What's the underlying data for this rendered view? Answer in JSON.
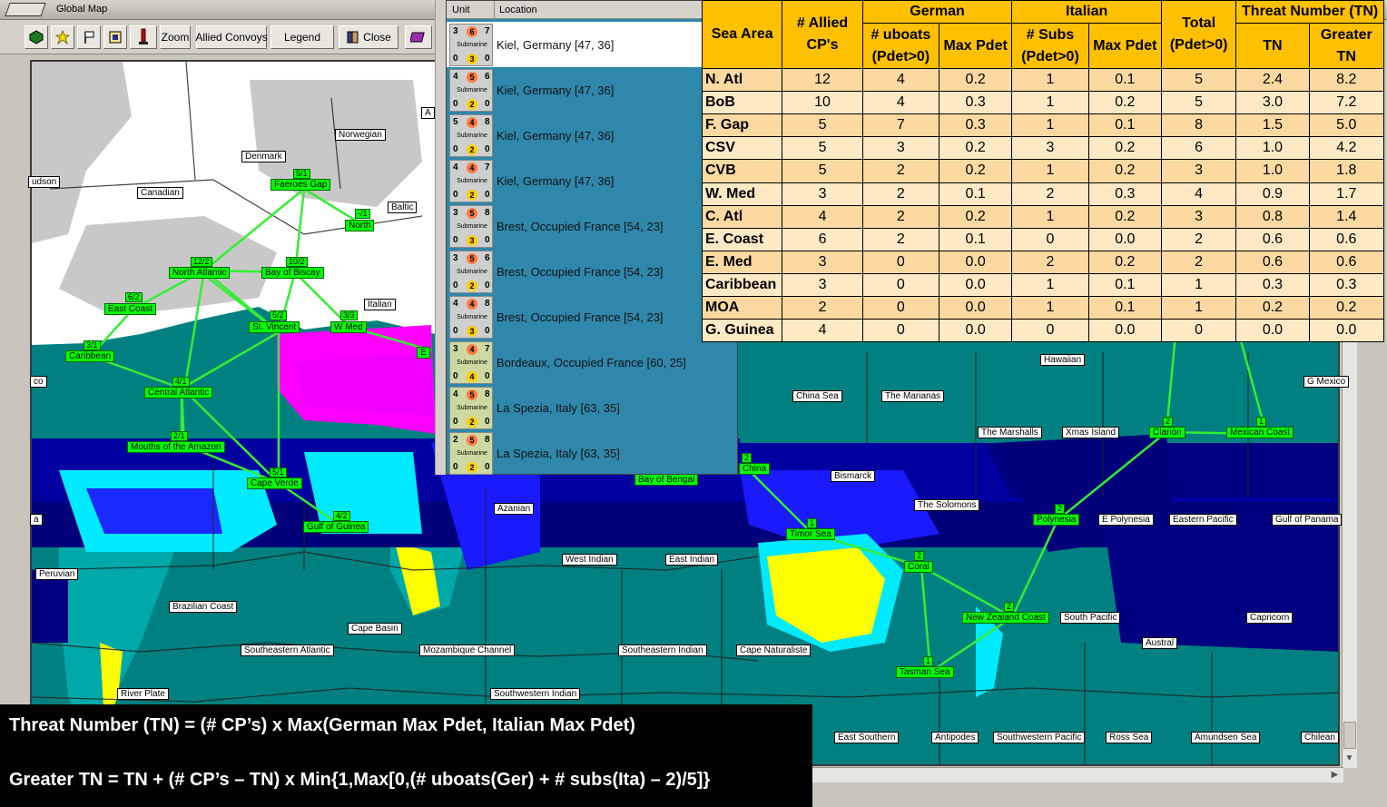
{
  "window": {
    "title": "Global Map"
  },
  "toolbar": {
    "zoom": "Zoom",
    "allied_convoys": "Allied Convoys",
    "legend": "Legend",
    "close": "Close"
  },
  "colors": {
    "ocean": "#008080",
    "land": "#ffffff",
    "detected": "#00ff00",
    "header": "#ffc000"
  },
  "units_panel": {
    "col_unit": "Unit",
    "col_location": "Location",
    "type_label": "Submarine",
    "rows": [
      {
        "t": "3",
        "tc": "6",
        "b": "7",
        "d": "0",
        "dc": "3",
        "e": "0",
        "loc": "Kiel, Germany [47, 36]",
        "ita": false
      },
      {
        "t": "4",
        "tc": "5",
        "b": "6",
        "d": "0",
        "dc": "2",
        "e": "0",
        "loc": "Kiel, Germany [47, 36]",
        "ita": false
      },
      {
        "t": "5",
        "tc": "4",
        "b": "8",
        "d": "0",
        "dc": "2",
        "e": "0",
        "loc": "Kiel, Germany [47, 36]",
        "ita": false
      },
      {
        "t": "4",
        "tc": "4",
        "b": "7",
        "d": "0",
        "dc": "2",
        "e": "0",
        "loc": "Kiel, Germany [47, 36]",
        "ita": false
      },
      {
        "t": "3",
        "tc": "5",
        "b": "8",
        "d": "0",
        "dc": "3",
        "e": "0",
        "loc": "Brest, Occupied France [54, 23]",
        "ita": false
      },
      {
        "t": "3",
        "tc": "5",
        "b": "6",
        "d": "0",
        "dc": "2",
        "e": "0",
        "loc": "Brest, Occupied France [54, 23]",
        "ita": false
      },
      {
        "t": "4",
        "tc": "4",
        "b": "8",
        "d": "0",
        "dc": "3",
        "e": "0",
        "loc": "Brest, Occupied France [54, 23]",
        "ita": false
      },
      {
        "t": "3",
        "tc": "4",
        "b": "7",
        "d": "0",
        "dc": "4",
        "e": "0",
        "loc": "Bordeaux, Occupied France [60, 25]",
        "ita": true
      },
      {
        "t": "4",
        "tc": "5",
        "b": "8",
        "d": "0",
        "dc": "2",
        "e": "0",
        "loc": "La Spezia, Italy [63, 35]",
        "ita": true
      },
      {
        "t": "2",
        "tc": "5",
        "b": "8",
        "d": "0",
        "dc": "2",
        "e": "0",
        "loc": "La Spezia, Italy [63, 35]",
        "ita": true
      }
    ]
  },
  "table": {
    "h_sea_area": "Sea Area",
    "h_allied": "# Allied CP's",
    "h_german": "German",
    "h_italian": "Italian",
    "h_total": "Total (Pdet>0)",
    "h_threat": "Threat Number (TN)",
    "h_uboats": "# uboats (Pdet>0)",
    "h_ger_max": "Max Pdet",
    "h_subs": "# Subs (Pdet>0)",
    "h_ita_max": "Max Pdet",
    "h_tn": "TN",
    "h_greater": "Greater TN",
    "rows": [
      [
        "N. Atl",
        "12",
        "4",
        "0.2",
        "1",
        "0.1",
        "5",
        "2.4",
        "8.2"
      ],
      [
        "BoB",
        "10",
        "4",
        "0.3",
        "1",
        "0.2",
        "5",
        "3.0",
        "7.2"
      ],
      [
        "F. Gap",
        "5",
        "7",
        "0.3",
        "1",
        "0.1",
        "8",
        "1.5",
        "5.0"
      ],
      [
        "CSV",
        "5",
        "3",
        "0.2",
        "3",
        "0.2",
        "6",
        "1.0",
        "4.2"
      ],
      [
        "CVB",
        "5",
        "2",
        "0.2",
        "1",
        "0.2",
        "3",
        "1.0",
        "1.8"
      ],
      [
        "W. Med",
        "3",
        "2",
        "0.1",
        "2",
        "0.3",
        "4",
        "0.9",
        "1.7"
      ],
      [
        "C. Atl",
        "4",
        "2",
        "0.2",
        "1",
        "0.2",
        "3",
        "0.8",
        "1.4"
      ],
      [
        "E. Coast",
        "6",
        "2",
        "0.1",
        "0",
        "0.0",
        "2",
        "0.6",
        "0.6"
      ],
      [
        "E. Med",
        "3",
        "0",
        "0.0",
        "2",
        "0.2",
        "2",
        "0.6",
        "0.6"
      ],
      [
        "Caribbean",
        "3",
        "0",
        "0.0",
        "1",
        "0.1",
        "1",
        "0.3",
        "0.3"
      ],
      [
        "MOA",
        "2",
        "0",
        "0.0",
        "1",
        "0.1",
        "1",
        "0.2",
        "0.2"
      ],
      [
        "G. Guinea",
        "4",
        "0",
        "0.0",
        "0",
        "0.0",
        "0",
        "0.0",
        "0.0"
      ]
    ]
  },
  "formula": {
    "line1": "Threat Number (TN) = (# CP’s) x Max(German Max Pdet, Italian Max Pdet)",
    "line2": "Greater TN = TN + (# CP’s – TN) x Min{1,Max[0,(# uboats(Ger) + # subs(Ita) – 2)/5]}"
  },
  "map_labels_white": [
    {
      "t": "Norwegian"
    },
    {
      "t": "Denmark"
    },
    {
      "t": "udson"
    },
    {
      "t": "Canadian"
    },
    {
      "t": "Baltic"
    },
    {
      "t": "Italian"
    },
    {
      "t": "co"
    },
    {
      "t": "Peruvian"
    },
    {
      "t": "Brazilian Coast"
    },
    {
      "t": "Cape Basin"
    },
    {
      "t": "Southeastern Atlantic"
    },
    {
      "t": "Mozambique Channel"
    },
    {
      "t": "River Plate"
    },
    {
      "t": "Southwestern Indian"
    },
    {
      "t": "Azanian"
    },
    {
      "t": "West Indian"
    },
    {
      "t": "East Indian"
    },
    {
      "t": "Southeastern Indian"
    },
    {
      "t": "Cape Naturaliste"
    },
    {
      "t": "Hawaiian"
    },
    {
      "t": "China Sea"
    },
    {
      "t": "The Marianas"
    },
    {
      "t": "The Marshalls"
    },
    {
      "t": "Xmas Island"
    },
    {
      "t": "Bismarck"
    },
    {
      "t": "The Solomons"
    },
    {
      "t": "E Polynesia"
    },
    {
      "t": "Eastern Pacific"
    },
    {
      "t": "Gulf of Panama"
    },
    {
      "t": "G Mexico"
    },
    {
      "t": "South Pacific"
    },
    {
      "t": "Capricorn"
    },
    {
      "t": "Austral"
    },
    {
      "t": "East Southern"
    },
    {
      "t": "Antipodes"
    },
    {
      "t": "Southwestern Pacific"
    },
    {
      "t": "Ross Sea"
    },
    {
      "t": "Amundsen Sea"
    },
    {
      "t": "Chilean"
    },
    {
      "t": "A"
    },
    {
      "t": "a"
    }
  ],
  "map_labels_green": [
    {
      "t": "Faeroes Gap",
      "c": "5/1"
    },
    {
      "t": "North",
      "c": "-/1"
    },
    {
      "t": "North Atlantic",
      "c": "12/2"
    },
    {
      "t": "Bay of Biscay",
      "c": "10/2"
    },
    {
      "t": "East Coast",
      "c": "6/2"
    },
    {
      "t": "St. Vincent",
      "c": "5/2"
    },
    {
      "t": "W Med",
      "c": "3/3"
    },
    {
      "t": "Caribbean",
      "c": "3/1"
    },
    {
      "t": "Central Atlantic",
      "c": "4/1"
    },
    {
      "t": "Mouths of the Amazon",
      "c": "2/1"
    },
    {
      "t": "Cape Verde",
      "c": "5/1"
    },
    {
      "t": "Gulf of Guinea",
      "c": "4/2"
    },
    {
      "t": "Bay of Bengal",
      "c": ""
    },
    {
      "t": "China",
      "c": "2"
    },
    {
      "t": "Timor Sea",
      "c": "1"
    },
    {
      "t": "Coral",
      "c": "2"
    },
    {
      "t": "Polynesia",
      "c": "2"
    },
    {
      "t": "Clarion",
      "c": "2"
    },
    {
      "t": "Mexican Coast",
      "c": "1"
    },
    {
      "t": "New Zealand Coast",
      "c": "2"
    },
    {
      "t": "Tasman Sea",
      "c": "1"
    },
    {
      "t": "E",
      "c": ""
    }
  ]
}
